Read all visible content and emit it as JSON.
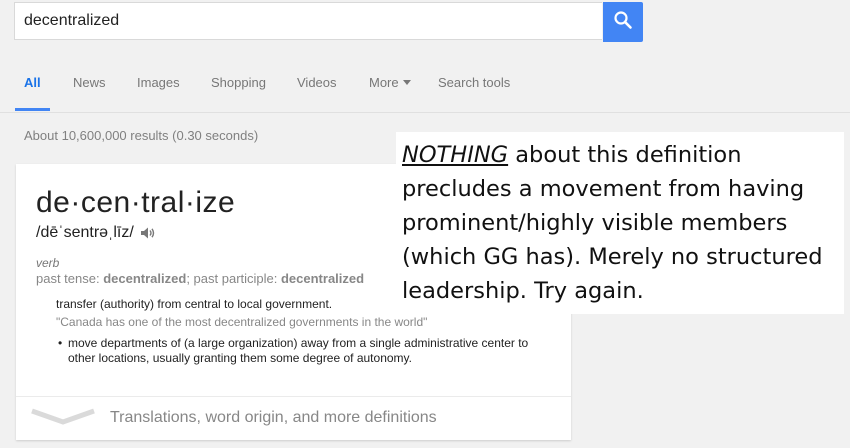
{
  "search": {
    "query": "decentralized"
  },
  "tabs": [
    {
      "label": "All"
    },
    {
      "label": "News"
    },
    {
      "label": "Images"
    },
    {
      "label": "Shopping"
    },
    {
      "label": "Videos"
    },
    {
      "label": "More"
    },
    {
      "label": "Search tools"
    }
  ],
  "results_stats": "About 10,600,000 results (0.30 seconds)",
  "dictionary": {
    "word": "de·cen·tral·ize",
    "phonetic": "/dēˈsentrəˌlīz/",
    "part_of_speech": "verb",
    "past_tense_label": "past tense: ",
    "past_tense": "decentralized",
    "separator": "; ",
    "past_participle_label": "past participle: ",
    "past_participle": "decentralized",
    "definition": "transfer (authority) from central to local government.",
    "example": "\"Canada has one of the most decentralized governments in the world\"",
    "subsense_bullet": "•",
    "subsense": "move departments of (a large organization) away from a single administrative center to other locations, usually granting them some degree of autonomy.",
    "footer": "Translations, word origin, and more definitions"
  },
  "annotation": {
    "emphasis": "NOTHING",
    "text": " about this definition precludes a movement from having prominent/highly visible members (which GG has). Merely no structured leadership. Try again."
  },
  "colors": {
    "accent": "#4285f4",
    "background": "#f1f1f1"
  },
  "icons": [
    "search-icon",
    "speaker-icon",
    "chevron-down-icon",
    "caret-down-icon"
  ]
}
